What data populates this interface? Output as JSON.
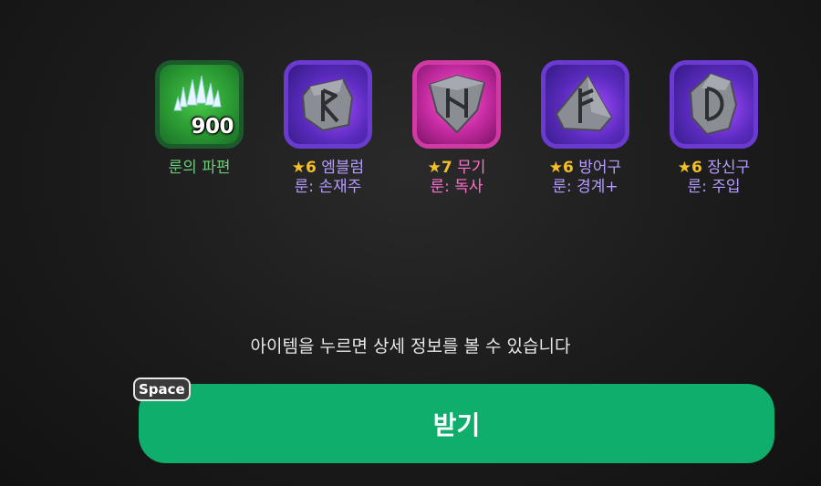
{
  "items": [
    {
      "name": "fragment",
      "icon": "rune-fragment-crystals-icon",
      "count": "900",
      "line1": "룬의 파편",
      "line2": ""
    },
    {
      "name": "emblem-rune",
      "icon": "rune-stone-r-icon",
      "stars": "★6",
      "line1": "엠블럼",
      "line2": "룬: 손재주"
    },
    {
      "name": "weapon-rune",
      "icon": "rune-stone-n-icon",
      "stars": "★7",
      "line1": "무기",
      "line2": "룬: 독사"
    },
    {
      "name": "armor-rune",
      "icon": "rune-stone-f-icon",
      "stars": "★6",
      "line1": "방어구",
      "line2": "룬: 경계+"
    },
    {
      "name": "accessory-rune",
      "icon": "rune-stone-d-icon",
      "stars": "★6",
      "line1": "장신구",
      "line2": "룬: 주입"
    }
  ],
  "hint": "아이템을 누르면 상세 정보를 볼 수 있습니다",
  "claim_button": {
    "label": "받기",
    "key": "Space"
  },
  "colors": {
    "claim": "#0fae6c",
    "purple_frame": "#6b3ad1",
    "pink_frame": "#cf3aa4",
    "green_frame": "#1c5a2c",
    "star": "#f3c028"
  }
}
